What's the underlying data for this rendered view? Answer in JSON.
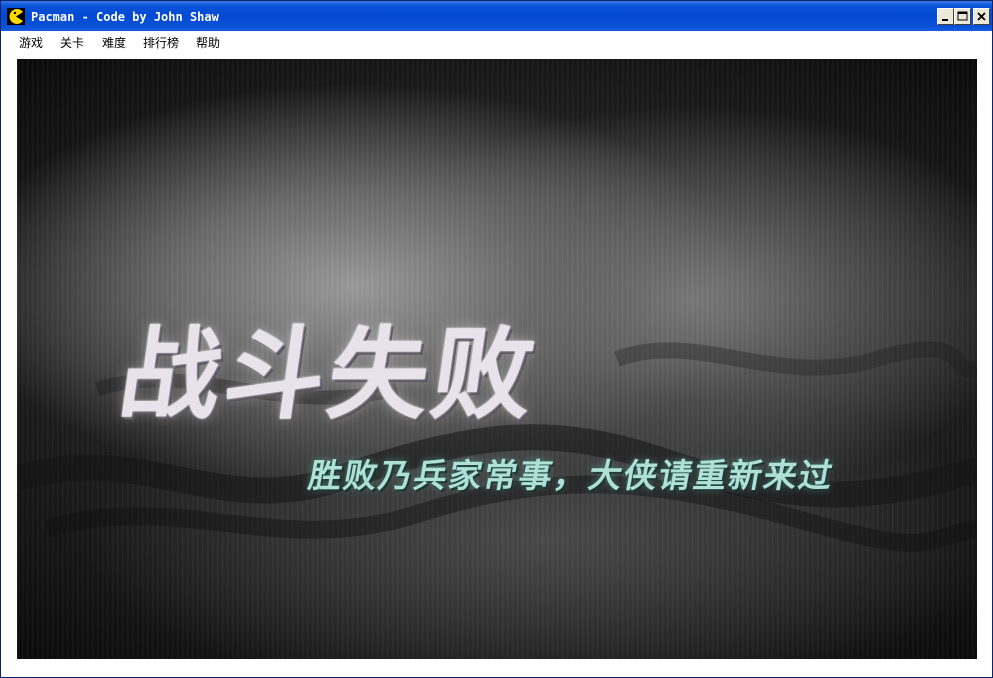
{
  "window": {
    "title": "Pacman - Code by John Shaw",
    "app_icon": "pacman-icon",
    "controls": [
      "minimize-icon",
      "maximize-icon",
      "close-icon"
    ]
  },
  "menu": {
    "items": [
      "游戏",
      "关卡",
      "难度",
      "排行榜",
      "帮助"
    ]
  },
  "game_screen": {
    "title": "战斗失败",
    "subtitle": "胜败乃兵家常事，大侠请重新来过",
    "colors": {
      "title": "#e8e2ea",
      "subtitle": "#aee0d6",
      "titlebar": "#0a55d8"
    }
  }
}
